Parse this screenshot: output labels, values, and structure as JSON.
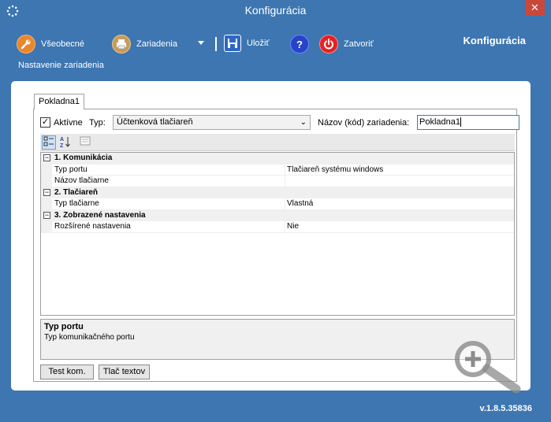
{
  "window": {
    "title": "Konfigurácia",
    "close_glyph": "✕"
  },
  "toolbar": {
    "general_label": "Všeobecné",
    "devices_label": "Zariadenia",
    "save_label": "Uložiť",
    "close_label": "Zatvoriť",
    "brand": "Konfigurácia",
    "subcaption": "Nastavenie zariadenia"
  },
  "tab": {
    "label": "Pokladna1"
  },
  "form": {
    "active_label": "Aktívne",
    "active_checked": "✓",
    "type_label": "Typ:",
    "type_value": "Účtenková tlačiareň",
    "name_label": "Názov (kód) zariadenia:",
    "name_value": "Pokladna1"
  },
  "grid": {
    "categories": [
      {
        "name": "1. Komunikácia",
        "props": [
          {
            "name": "Typ portu",
            "value": "Tlačiareň systému windows"
          },
          {
            "name": "Názov tlačiarne",
            "value": ""
          }
        ]
      },
      {
        "name": "2. Tlačiareň",
        "props": [
          {
            "name": "Typ tlačiarne",
            "value": "Vlastná"
          }
        ]
      },
      {
        "name": "3. Zobrazené nastavenia",
        "props": [
          {
            "name": "Rozšírené nastavenia",
            "value": "Nie"
          }
        ]
      }
    ],
    "collapse_glyph": "−"
  },
  "help": {
    "title": "Typ portu",
    "desc": "Typ komunikačného portu"
  },
  "buttons": {
    "test_label": "Test kom.",
    "print_label": "Tlač textov"
  },
  "version": "v.1.8.5.35836",
  "colors": {
    "window_bg": "#3d76b1",
    "close_red": "#c9483c",
    "accent_orange": "#e8872e",
    "help_blue": "#2743c8",
    "power_red": "#e32222"
  },
  "icons": {
    "app": "loading-spinner-icon",
    "general": "wrench-icon",
    "devices": "printer-icon",
    "save": "floppy-disk-icon",
    "help": "question-mark-icon",
    "close": "power-icon",
    "categorized": "categorized-view-icon",
    "alphabetical": "sort-az-icon",
    "property_pages": "property-pages-icon",
    "zoom": "magnifier-plus-icon"
  }
}
